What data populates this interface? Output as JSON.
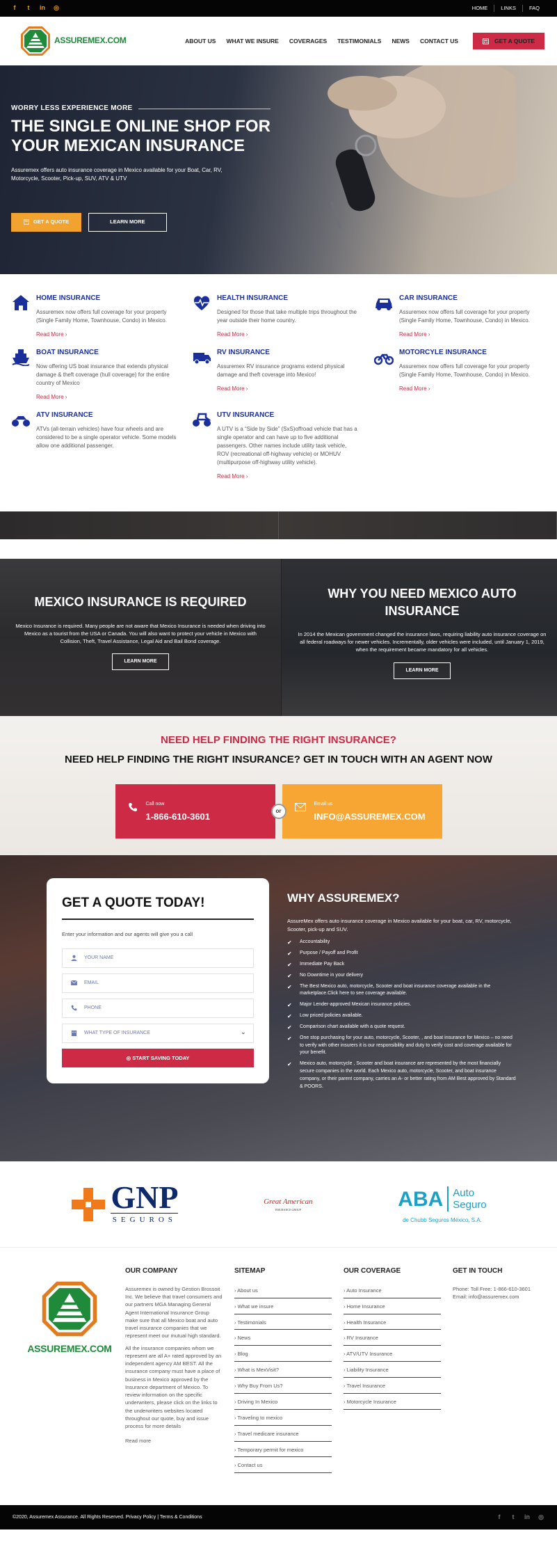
{
  "topbar": {
    "social": [
      {
        "icon": "facebook-icon",
        "glyph": "f"
      },
      {
        "icon": "twitter-icon",
        "glyph": "t"
      },
      {
        "icon": "linkedin-icon",
        "glyph": "in"
      },
      {
        "icon": "instagram-icon",
        "glyph": "◎"
      }
    ],
    "links": [
      "HOME",
      "LINKS",
      "FAQ"
    ]
  },
  "header": {
    "logo_text": "ASSUREMEX.COM",
    "nav": [
      "ABOUT US",
      "WHAT WE INSURE",
      "COVERAGES",
      "TESTIMONIALS",
      "NEWS",
      "CONTACT US"
    ],
    "cta": "GET A QUOTE"
  },
  "hero": {
    "eyebrow": "WORRY LESS EXPERIENCE MORE",
    "title": "THE SINGLE ONLINE SHOP FOR YOUR MEXICAN INSURANCE",
    "text": "Assuremex offers auto insurance coverage in Mexico available for your Boat, Car, RV, Motorcycle, Scooter, Pick-up, SUV, ATV & UTV",
    "btn_quote": "GET A QUOTE",
    "btn_more": "LEARN MORE"
  },
  "services": [
    {
      "title": "HOME INSURANCE",
      "icon": "home-icon",
      "text": "Assuremex now offers full coverage for your property (Single Family Home, Townhouse, Condo) in Mexico.",
      "more": "Read More ›"
    },
    {
      "title": "HEALTH INSURANCE",
      "icon": "heartbeat-icon",
      "text": "Designed for those that take multiple trips throughout the year outside their home country.",
      "more": "Read More ›"
    },
    {
      "title": "CAR INSURANCE",
      "icon": "car-icon",
      "text": "Assuremex now offers full coverage for your property (Single Family Home, Townhouse, Condo) in Mexico.",
      "more": "Read More ›"
    },
    {
      "title": "BOAT INSURANCE",
      "icon": "ship-icon",
      "text": "Now offering US boat insurance that extends physical damage & theft coverage (hull coverage) for the entire country of Mexico",
      "more": "Read More ›"
    },
    {
      "title": "RV INSURANCE",
      "icon": "rv-truck-icon",
      "text": "Assuremex RV insurance programs extend physical damage and theft coverage into Mexico!",
      "more": "Read More ›"
    },
    {
      "title": "MOTORCYLE INSURANCE",
      "icon": "motorcycle-icon",
      "text": "Assuremex now offers full coverage for your property (Single Family Home, Townhouse, Condo) in Mexico.",
      "more": "Read More ›"
    },
    {
      "title": "ATV INSURANCE",
      "icon": "atv-icon",
      "text": "ATVs (all-terrain vehicles) have four wheels and are considered to be a single operator vehicle. Some models allow one additional passenger.",
      "more": ""
    },
    {
      "title": "UTV INSURANCE",
      "icon": "utv-icon",
      "text": "A UTV is a “Side by Side” (SxS)offroad vehicle that has a single operator and can have up to five additional passengers. Other names include utility task vehicle, ROV (recreational off-highway vehicle) or MOHUV (multipurpose off-highway utility vehicle).",
      "more": "Read More ›"
    }
  ],
  "panels": {
    "left": {
      "title": "MEXICO INSURANCE IS REQUIRED",
      "text": "Mexico Insurance is required. Many people are not aware that Mexico Insurance is needed when driving into Mexico as a tourist from the USA or Canada. You will also want to protect your vehicle in Mexico with Collision, Theft, Travel Assistance, Legal Aid and Bail Bond coverage.",
      "btn": "LEARN MORE"
    },
    "right": {
      "title": "WHY YOU NEED MEXICO AUTO INSURANCE",
      "text": "In 2014 the Mexican government changed the insurance laws, requiring liability auto insurance coverage on all federal roadways for newer vehicles. Incrementally, older vehicles were included, until January 1, 2019, when the requirement became mandatory for all vehicles.",
      "btn": "LEARN MORE"
    }
  },
  "help": {
    "title_red": "NEED HELP FINDING THE RIGHT INSURANCE?",
    "title_dark": "NEED HELP FINDING THE RIGHT INSURANCE? GET IN TOUCH WITH AN AGENT NOW",
    "call_label": "Call now",
    "call_value": "1-866-610-3601",
    "or": "or",
    "email_label": "Email us",
    "email_value": "INFO@ASSUREMEX.COM"
  },
  "quote": {
    "title": "GET A QUOTE TODAY!",
    "intro": "Enter your information and our agents will give you a call",
    "name_placeholder": "YOUR NAME",
    "email_placeholder": "EMAIL",
    "phone_placeholder": "PHONE",
    "type_placeholder": "WHAT TYPE OF INSURANCE",
    "submit": "START SAVING TODAY"
  },
  "why": {
    "title": "WHY ASSUREMEX?",
    "lead": "AssureMex offers auto insurance coverage in Mexico available for your boat, car, RV, motorcycle, Scooter, pick-up and SUV.",
    "items": [
      "Accountability",
      "Purpose / Payoff and Profit",
      "Immediate Pay Back",
      "No Downtime in your delivery",
      "The Best Mexico auto, motorcycle, Scooter and boat insurance coverage available in the marketplace.Click here to see coverage available.",
      "Major Lender-approved Mexican insurance policies.",
      "Low priced policies available.",
      "Comparison chart available with a quote request.",
      "One stop purchasing for your auto, motorcycle, Scooter, , and boat insurance for Mexico – no need to verify with other insurers it is our responsibility and duty to verify cost and coverage available for your benefit.",
      "Mexico auto, motorcycle , Scooter and boat insurance are represented by the most financially secure companies in the world. Each Mexico auto, motorcycle, Scooter, and boat insurance company, or their parent company, carries an A- or better rating from AM Best approved by Standard & POORS."
    ]
  },
  "insurers": {
    "gnp": "GNP",
    "gnp_sub": "SEGUROS",
    "great": "Great American",
    "great_sub": "INSURANCE GROUP",
    "aba": "ABA",
    "aba_side1": "Auto",
    "aba_side2": "Seguro",
    "aba_sub": "de Chubb Seguros México, S.A."
  },
  "footer": {
    "logo_text": "ASSUREMEX.COM",
    "company": {
      "title": "OUR COMPANY",
      "p1": "Assuremex is owned by Gestion Brossoit Inc. We believe that travel consumers and our partners MGA Managing General Agent International Insurance Group make sure that all Mexico boat and auto travel insurance companies that we represent meet our mutual high standard.",
      "p2": "All the insurance companies whom we represent are all A+ rated approved by an independent agency AM BEST. All the insurance company must have a place of business in Mexico approved by the Insurance department of Mexico. To review information on the specific underwriters, please click on the links to the underwriters websites located throughout our quote, buy and issue process for more details",
      "more": "Read more"
    },
    "sitemap": {
      "title": "SITEMAP",
      "links": [
        "About us",
        "What we insure",
        "Testimonials",
        "News",
        "Blog",
        "What is MexVisit?",
        "Why Buy From Us?",
        "Driving In Mexico",
        "Traveling to mexico",
        "Travel medicare insurance",
        "Temporary permit for mexico",
        "Contact us"
      ]
    },
    "coverage": {
      "title": "OUR COVERAGE",
      "links": [
        "Auto Insurance",
        "Home Insurance",
        "Health Insurance",
        "RV Insurance",
        "ATV/UTV Insurance",
        "Liability Insurance",
        "Travel Insurance",
        "Motorcycle Insurance"
      ]
    },
    "touch": {
      "title": "GET IN TOUCH",
      "phone": "Phone: Toll Free: 1-866-610-3601",
      "email": "Email: info@assuremex.com"
    }
  },
  "bottombar": {
    "copy": "©2020, Assuremex Assurance. All Rights Reserved. Privacy Policy | Terms & Conditions"
  },
  "colors": {
    "brand_red": "#cc2a45",
    "brand_orange": "#f2a22e",
    "brand_blue": "#1b2f9a",
    "logo_green": "#1f8a3a"
  }
}
